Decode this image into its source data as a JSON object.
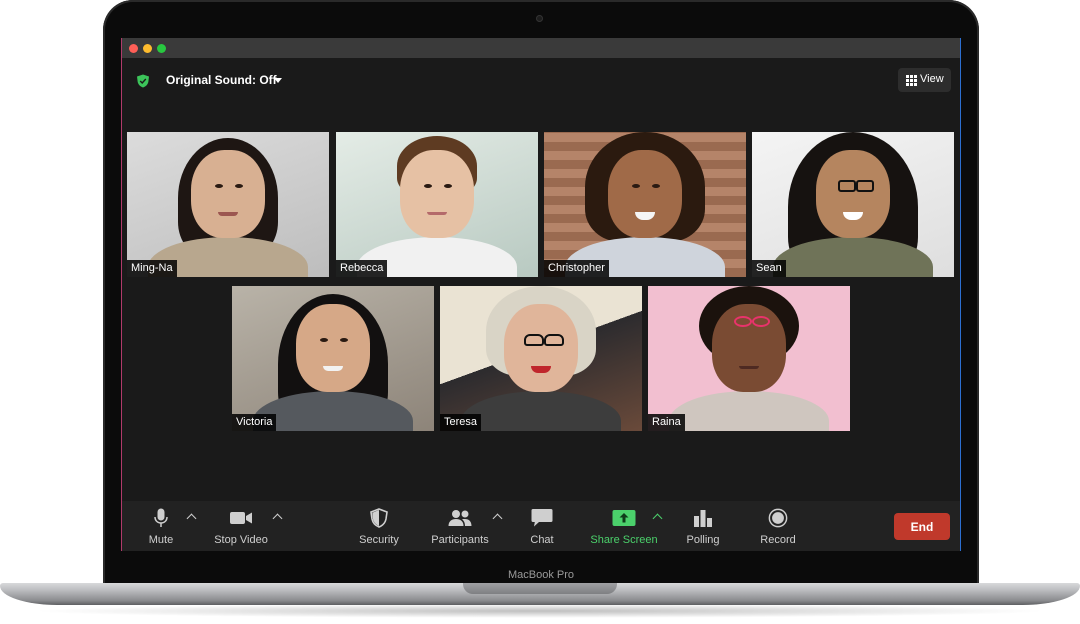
{
  "window": {
    "sound_label": "Original Sound: Off",
    "view_label": "View"
  },
  "participants": [
    {
      "name": "Ming-Na"
    },
    {
      "name": "Rebecca"
    },
    {
      "name": "Christopher"
    },
    {
      "name": "Sean"
    },
    {
      "name": "Victoria"
    },
    {
      "name": "Teresa"
    },
    {
      "name": "Raina"
    }
  ],
  "toolbar": {
    "mute": "Mute",
    "stop_video": "Stop Video",
    "security": "Security",
    "participants": "Participants",
    "chat": "Chat",
    "share_screen": "Share Screen",
    "polling": "Polling",
    "record": "Record",
    "end": "End"
  },
  "device": {
    "label": "MacBook Pro"
  },
  "colors": {
    "accent_green": "#4bd06b",
    "end_red": "#c0392b",
    "background": "#1a1a1a"
  },
  "icons": [
    "shield-icon",
    "caret-down-icon",
    "grid-icon",
    "microphone-icon",
    "video-camera-icon",
    "security-shield-icon",
    "participants-icon",
    "chat-bubble-icon",
    "share-screen-icon",
    "polling-icon",
    "record-icon"
  ]
}
